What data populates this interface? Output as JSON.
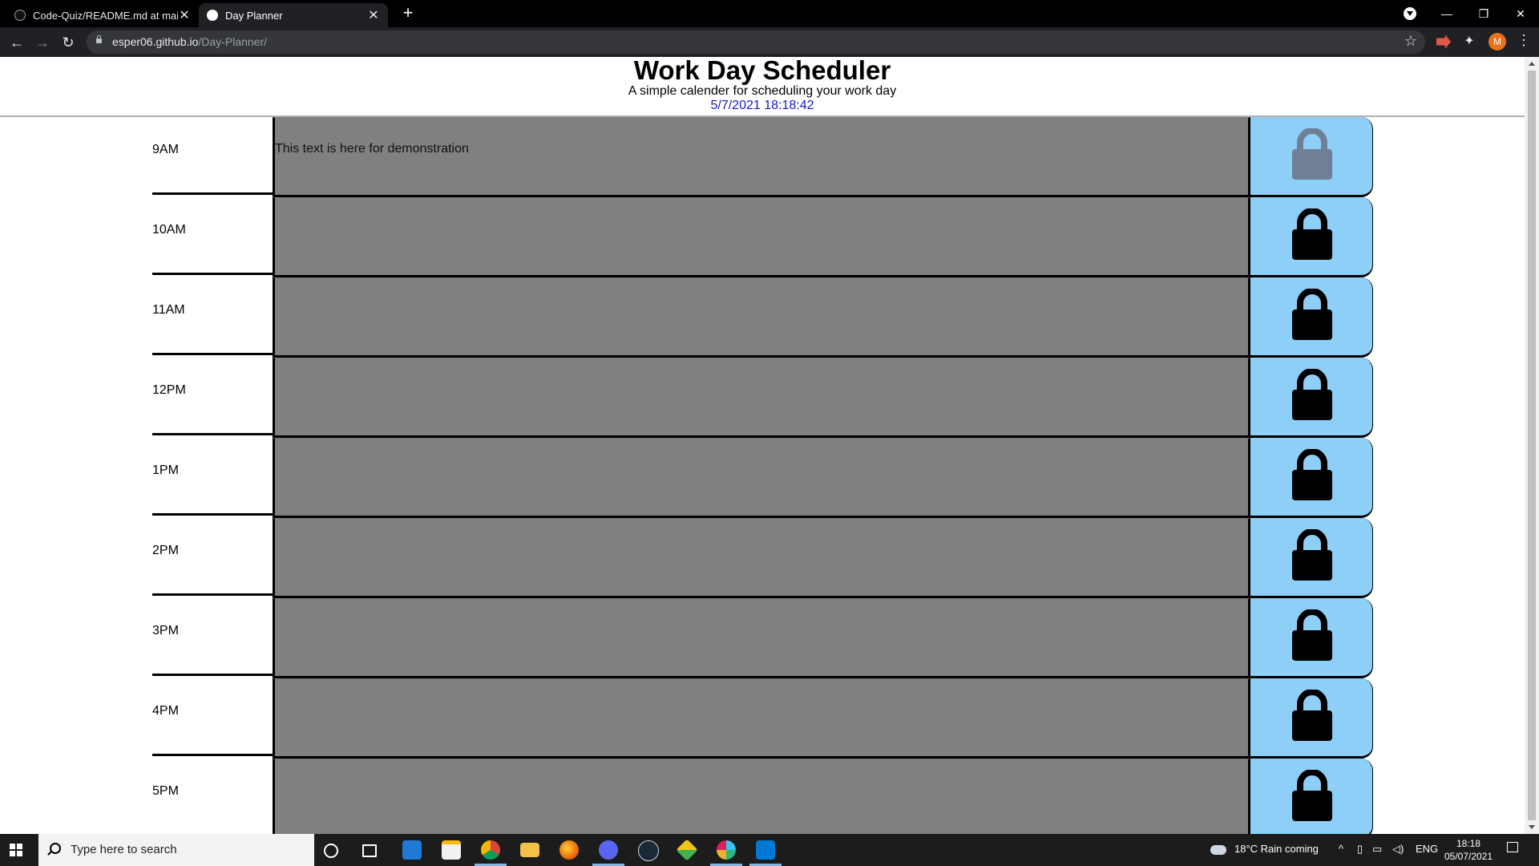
{
  "browser": {
    "tabs": [
      {
        "title": "Code-Quiz/README.md at main",
        "active": false
      },
      {
        "title": "Day Planner",
        "active": true
      }
    ],
    "url_host": "esper06.github.io",
    "url_path": "/Day-Planner/",
    "profile_initial": "M"
  },
  "page": {
    "title": "Work Day Scheduler",
    "lead": "A simple calender for scheduling your work day",
    "datetime": "5/7/2021 18:18:42"
  },
  "schedule": [
    {
      "hour": "9AM",
      "text": "This text is here for demonstration",
      "lock_state": "past-dim"
    },
    {
      "hour": "10AM",
      "text": "",
      "lock_state": "locked"
    },
    {
      "hour": "11AM",
      "text": "",
      "lock_state": "locked"
    },
    {
      "hour": "12PM",
      "text": "",
      "lock_state": "locked"
    },
    {
      "hour": "1PM",
      "text": "",
      "lock_state": "locked"
    },
    {
      "hour": "2PM",
      "text": "",
      "lock_state": "locked"
    },
    {
      "hour": "3PM",
      "text": "",
      "lock_state": "locked"
    },
    {
      "hour": "4PM",
      "text": "",
      "lock_state": "locked"
    },
    {
      "hour": "5PM",
      "text": "",
      "lock_state": "locked"
    }
  ],
  "colors": {
    "row_background": "#808080",
    "save_button": "#8ecff8",
    "lock_active": "#000000",
    "lock_dim": "#6f7f96",
    "datetime_text": "#1818c8"
  },
  "taskbar": {
    "search_placeholder": "Type here to search",
    "weather": "18°C  Rain coming",
    "language": "ENG",
    "time": "18:18",
    "date": "05/07/2021"
  }
}
